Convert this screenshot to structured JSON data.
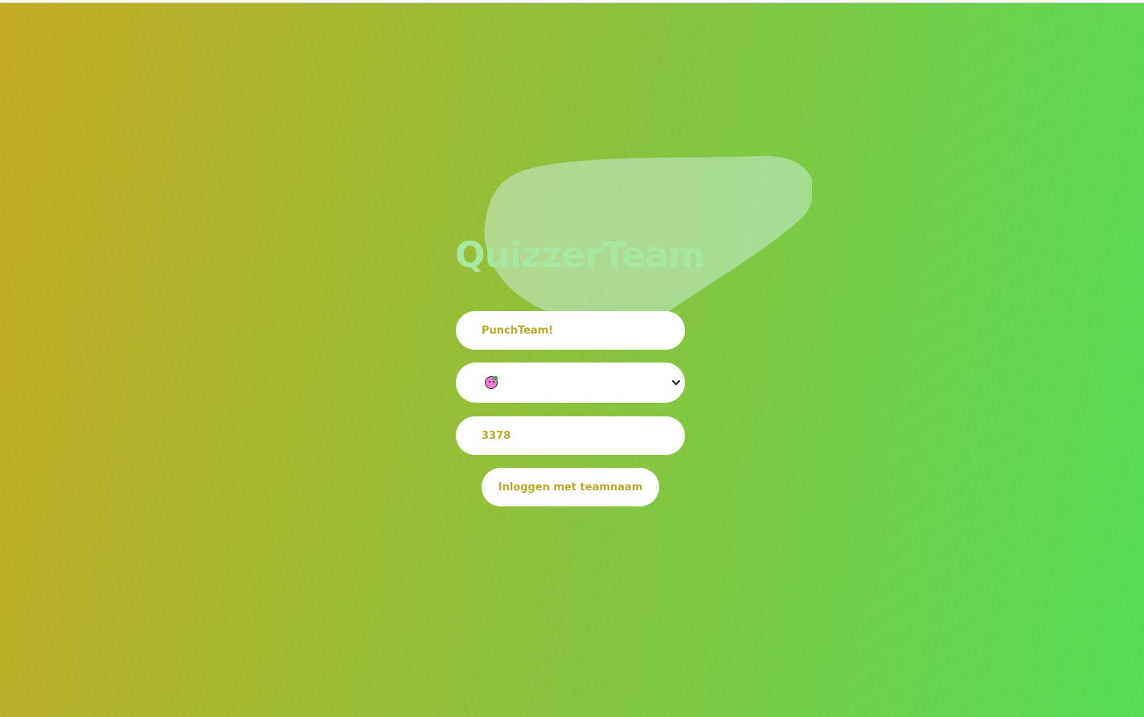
{
  "app": {
    "logo_text": "QuizzerTeam"
  },
  "form": {
    "team_name_value": "PunchTeam!",
    "avatar_select": {
      "selected_icon": "pink-pig-emoji-icon"
    },
    "code_value": "3378",
    "login_button_label": "Inloggen met teamnaam"
  },
  "colors": {
    "background_gradient_start": "#c4ab25",
    "background_gradient_end": "#55dd55",
    "logo_color": "#a6e8a0",
    "field_text_color": "#b9aa2a",
    "field_background": "#ffffff"
  }
}
